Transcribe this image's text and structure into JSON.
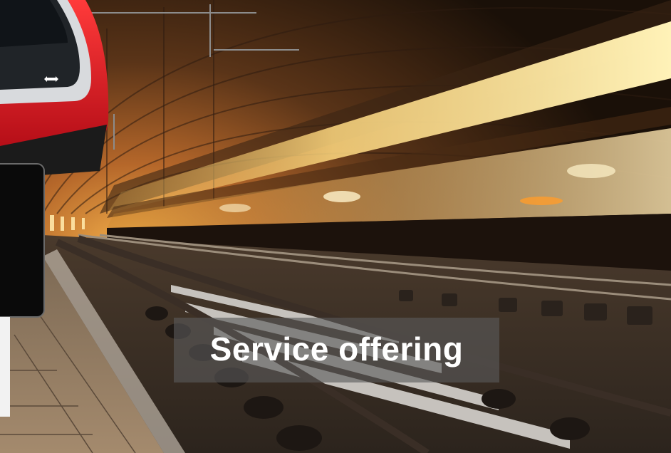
{
  "caption": {
    "text": "Service offering"
  },
  "photo": {
    "subject-icon": "train-tunnel-photo",
    "train_logo-icon": "double-arrow-rail-logo"
  }
}
